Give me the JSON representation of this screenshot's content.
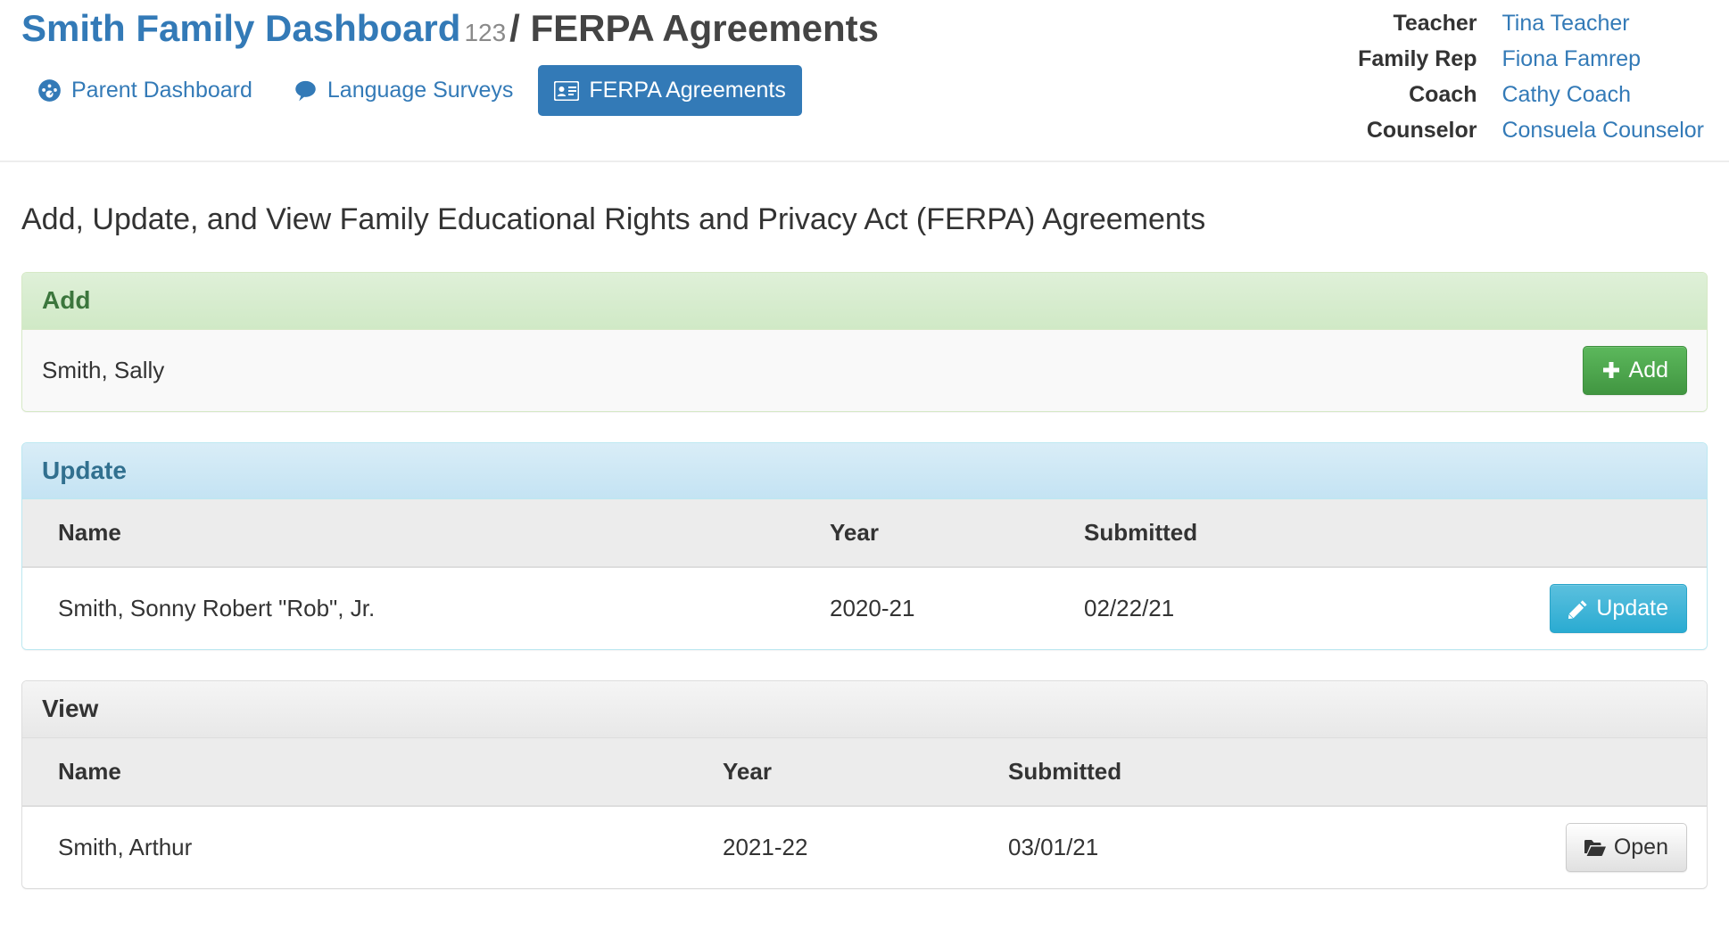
{
  "header": {
    "brand": "Smith Family Dashboard",
    "brand_id": "123",
    "separator": "/",
    "section": "FERPA Agreements",
    "brand_color": "#337ab7",
    "nav": [
      {
        "label": "Parent Dashboard",
        "icon": "tachometer-icon",
        "active": false
      },
      {
        "label": "Language Surveys",
        "icon": "comment-icon",
        "active": false
      },
      {
        "label": "FERPA Agreements",
        "icon": "id-card-icon",
        "active": true
      }
    ],
    "contacts": [
      {
        "role": "Teacher",
        "name": "Tina Teacher"
      },
      {
        "role": "Family Rep",
        "name": "Fiona Famrep"
      },
      {
        "role": "Coach",
        "name": "Cathy Coach"
      },
      {
        "role": "Counselor",
        "name": "Consuela Counselor"
      }
    ]
  },
  "main": {
    "subtitle": "Add, Update, and View Family Educational Rights and Privacy Act (FERPA) Agreements",
    "add_panel": {
      "title": "Add",
      "accent": "#3c763d",
      "row_label": "Smith, Sally",
      "button_label": "Add",
      "button_icon": "plus-icon"
    },
    "update_panel": {
      "title": "Update",
      "accent": "#31708f",
      "columns": [
        "Name",
        "Year",
        "Submitted",
        ""
      ],
      "rows": [
        {
          "name": "Smith, Sonny Robert \"Rob\", Jr.",
          "year": "2020-21",
          "submitted": "02/22/21",
          "button_label": "Update",
          "button_icon": "pencil-icon"
        }
      ]
    },
    "view_panel": {
      "title": "View",
      "accent": "#333333",
      "columns": [
        "Name",
        "Year",
        "Submitted",
        ""
      ],
      "rows": [
        {
          "name": "Smith, Arthur",
          "year": "2021-22",
          "submitted": "03/01/21",
          "button_label": "Open",
          "button_icon": "folder-open-icon"
        }
      ]
    }
  }
}
